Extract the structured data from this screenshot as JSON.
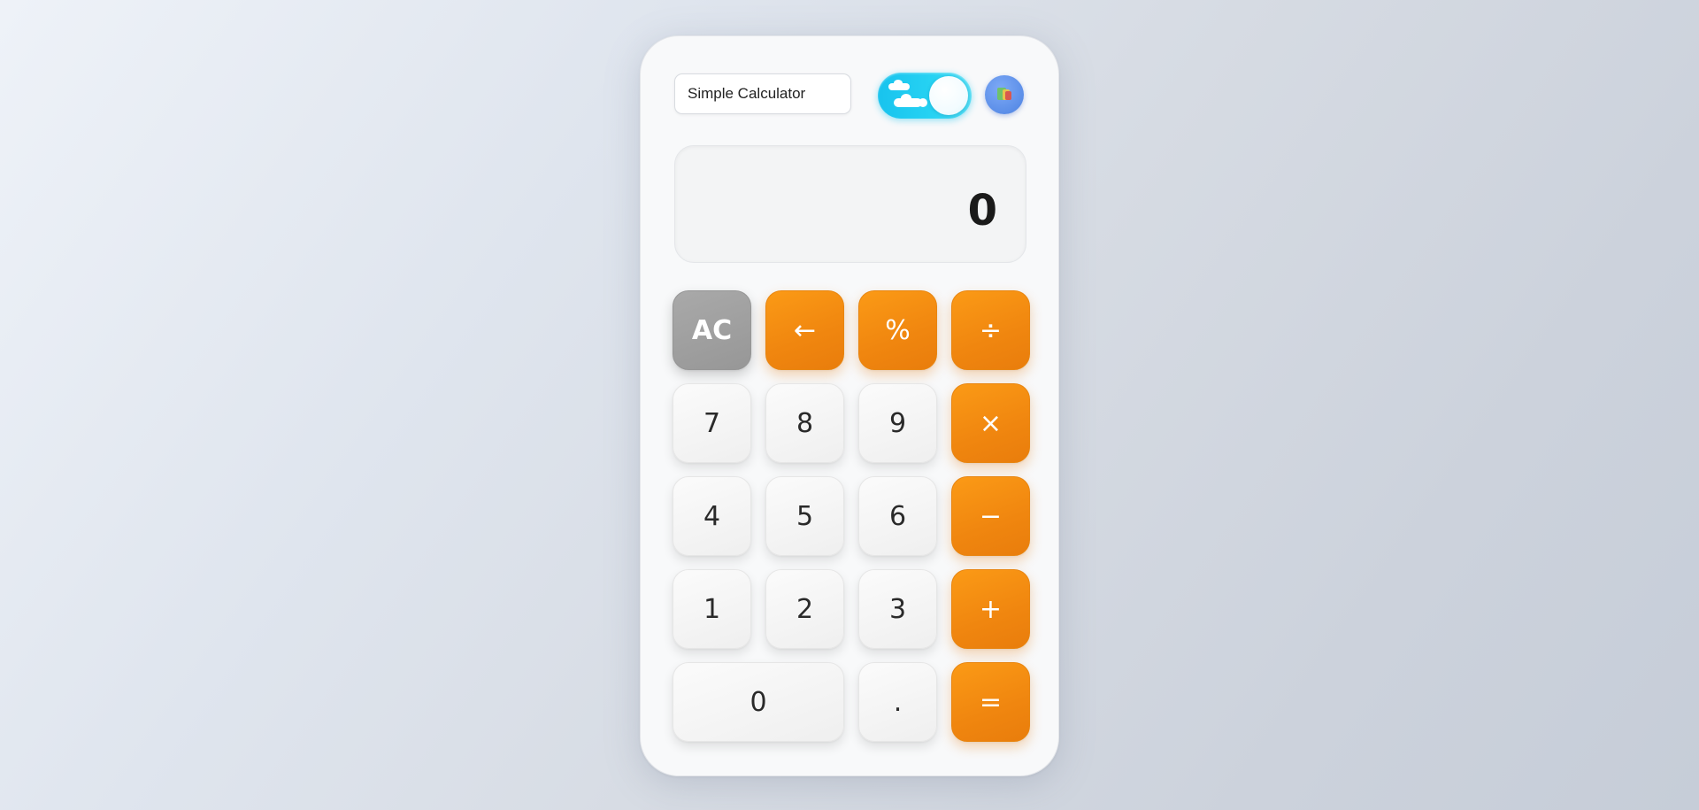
{
  "header": {
    "title": "Simple Calculator",
    "theme_toggle_state": "light",
    "theme_toggle_colors": {
      "track": "#18c3ee",
      "knob": "#ffffff"
    },
    "palette_button_color": "#5b8ee8"
  },
  "display": {
    "value": "0"
  },
  "keypad": {
    "row1": {
      "clear": "AC",
      "backspace": "←",
      "percent": "%",
      "divide": "÷"
    },
    "row2": {
      "seven": "7",
      "eight": "8",
      "nine": "9",
      "multiply": "×"
    },
    "row3": {
      "four": "4",
      "five": "5",
      "six": "6",
      "subtract": "−"
    },
    "row4": {
      "one": "1",
      "two": "2",
      "three": "3",
      "add": "+"
    },
    "row5": {
      "zero": "0",
      "decimal": ".",
      "equals": "="
    }
  },
  "colors": {
    "operator": "#f78f12",
    "clear": "#a0a0a0",
    "number": "#f5f5f5"
  }
}
